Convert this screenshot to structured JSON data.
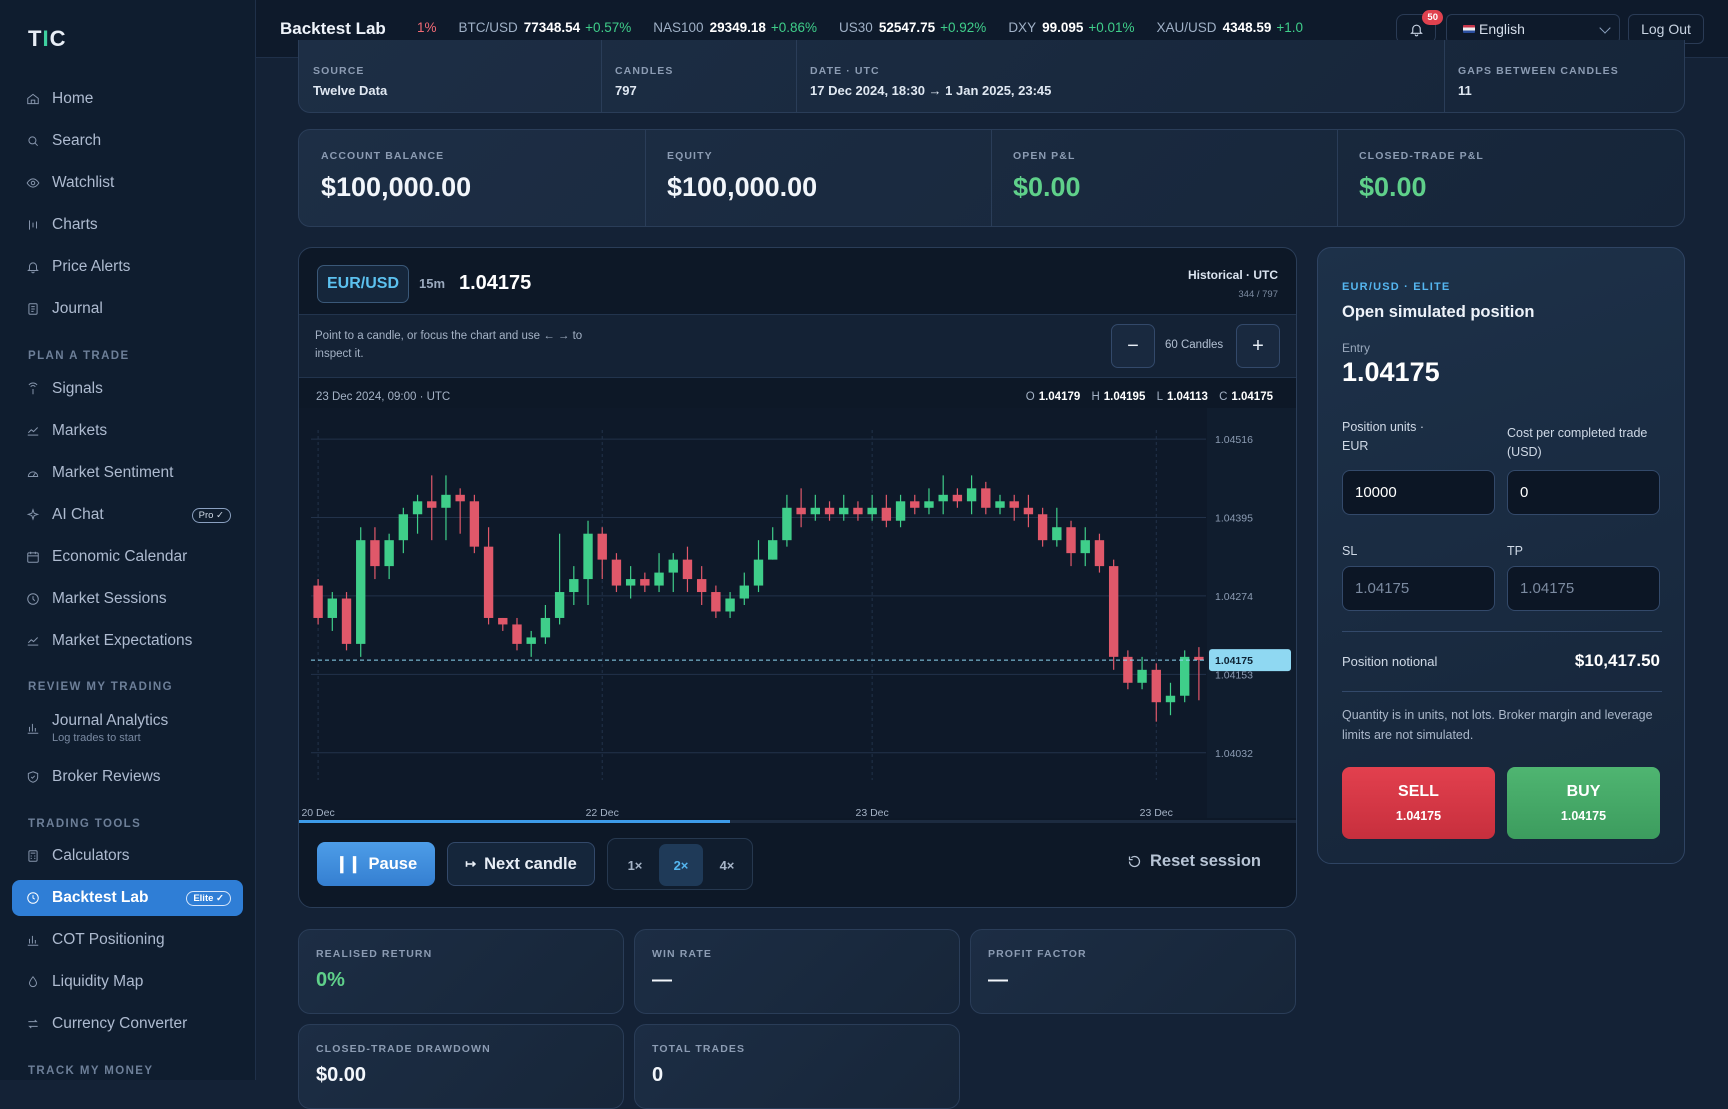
{
  "sidebar": {
    "logo_main": "T",
    "logo_accent": "I",
    "logo_tail": "C",
    "items": [
      {
        "label": "Home",
        "icon": "home-icon"
      },
      {
        "label": "Search",
        "icon": "search-icon"
      },
      {
        "label": "Watchlist",
        "icon": "eye-icon"
      },
      {
        "label": "Charts",
        "icon": "chart-icon"
      },
      {
        "label": "Price Alerts",
        "icon": "bell-icon"
      },
      {
        "label": "Journal",
        "icon": "journal-icon"
      }
    ],
    "section_plan": "PLAN A TRADE",
    "plan_items": [
      {
        "label": "Signals",
        "icon": "signal-icon"
      },
      {
        "label": "Markets",
        "icon": "trend-icon"
      },
      {
        "label": "Market Sentiment",
        "icon": "gauge-icon"
      },
      {
        "label": "AI Chat",
        "icon": "sparkle-icon",
        "badge": "Pro ✓"
      },
      {
        "label": "Economic Calendar",
        "icon": "calendar-icon"
      },
      {
        "label": "Market Sessions",
        "icon": "clock-icon"
      },
      {
        "label": "Market Expectations",
        "icon": "trend-icon"
      }
    ],
    "section_review": "REVIEW MY TRADING",
    "review_items": [
      {
        "label": "Journal Analytics",
        "sub": "Log trades to start",
        "icon": "bar-chart-icon"
      },
      {
        "label": "Broker Reviews",
        "icon": "shield-icon"
      }
    ],
    "section_tools": "TRADING TOOLS",
    "tool_items": [
      {
        "label": "Calculators",
        "icon": "calculator-icon"
      },
      {
        "label": "Backtest Lab",
        "icon": "history-icon",
        "badge": "Elite ✓",
        "active": true
      },
      {
        "label": "COT Positioning",
        "icon": "bar-chart-icon"
      },
      {
        "label": "Liquidity Map",
        "icon": "drop-icon"
      },
      {
        "label": "Currency Converter",
        "icon": "swap-icon"
      }
    ],
    "section_money": "TRACK MY MONEY"
  },
  "topbar": {
    "title": "Backtest Lab",
    "ticker": [
      {
        "sym": "",
        "px": "",
        "ch": "1%",
        "down": true
      },
      {
        "sym": "BTC/USD",
        "px": "77348.54",
        "ch": "+0.57%"
      },
      {
        "sym": "NAS100",
        "px": "29349.18",
        "ch": "+0.86%"
      },
      {
        "sym": "US30",
        "px": "52547.75",
        "ch": "+0.92%"
      },
      {
        "sym": "DXY",
        "px": "99.095",
        "ch": "+0.01%"
      },
      {
        "sym": "XAU/USD",
        "px": "4348.59",
        "ch": "+1.0"
      }
    ],
    "notifications": "50",
    "language": "English",
    "logout": "Log Out"
  },
  "info": [
    {
      "label": "SOURCE",
      "value": "Twelve Data"
    },
    {
      "label": "CANDLES",
      "value": "797"
    },
    {
      "label": "DATE · UTC",
      "value": "17 Dec 2024, 18:30 → 1 Jan 2025, 23:45"
    },
    {
      "label": "GAPS BETWEEN CANDLES",
      "value": "11"
    }
  ],
  "stats": [
    {
      "label": "ACCOUNT BALANCE",
      "value": "$100,000.00"
    },
    {
      "label": "EQUITY",
      "value": "$100,000.00"
    },
    {
      "label": "OPEN P&L",
      "value": "$0.00"
    },
    {
      "label": "CLOSED-TRADE P&L",
      "value": "$0.00"
    }
  ],
  "chart_panel": {
    "pair": "EUR/USD",
    "timeframe": "15m",
    "price": "1.04175",
    "mode": "Historical · UTC",
    "position": "344 / 797",
    "hint": "Point to a candle, or focus the chart and use ← → to inspect it.",
    "zoom_out": "−",
    "zoom_in": "+",
    "zoom_label": "60 Candles",
    "candle_date": "23 Dec 2024, 09:00 · UTC",
    "o_label": "O",
    "o": "1.04179",
    "h_label": "H",
    "h": "1.04195",
    "l_label": "L",
    "l": "1.04113",
    "c_label": "C",
    "c": "1.04175",
    "progress": 0.432,
    "pause": "Pause",
    "next": "Next candle",
    "speeds": [
      "1×",
      "2×",
      "4×"
    ],
    "active_speed": 1,
    "reset": "Reset session"
  },
  "chart_data": {
    "type": "candlestick",
    "ylim": [
      1.0399,
      1.0453
    ],
    "y_ticks": [
      "1.04516",
      "1.04395",
      "1.04274",
      "1.04153",
      "1.04032"
    ],
    "y_tick_values": [
      1.04516,
      1.04395,
      1.04274,
      1.04153,
      1.04032
    ],
    "x_ticks": [
      "20 Dec",
      "22 Dec",
      "23 Dec",
      "23 Dec"
    ],
    "x_tick_index": [
      0,
      20,
      39,
      59
    ],
    "current_price_label": "1.04175",
    "current_price": 1.04175,
    "candles": [
      [
        1.0429,
        1.0424,
        1.043,
        1.0423
      ],
      [
        1.0424,
        1.0427,
        1.0428,
        1.0422
      ],
      [
        1.0427,
        1.042,
        1.0428,
        1.0419
      ],
      [
        1.042,
        1.0436,
        1.0438,
        1.0418
      ],
      [
        1.0436,
        1.0432,
        1.0438,
        1.043
      ],
      [
        1.0432,
        1.0436,
        1.0437,
        1.043
      ],
      [
        1.0436,
        1.044,
        1.0441,
        1.0434
      ],
      [
        1.044,
        1.0442,
        1.0443,
        1.0437
      ],
      [
        1.0442,
        1.0441,
        1.0446,
        1.0436
      ],
      [
        1.0441,
        1.0443,
        1.0446,
        1.0436
      ],
      [
        1.0443,
        1.0442,
        1.0444,
        1.0437
      ],
      [
        1.0442,
        1.0435,
        1.0443,
        1.0434
      ],
      [
        1.0435,
        1.0424,
        1.0438,
        1.0423
      ],
      [
        1.0424,
        1.0423,
        1.0424,
        1.0422
      ],
      [
        1.0423,
        1.042,
        1.0424,
        1.0419
      ],
      [
        1.042,
        1.0421,
        1.0422,
        1.0418
      ],
      [
        1.0421,
        1.0424,
        1.0426,
        1.042
      ],
      [
        1.0424,
        1.0428,
        1.0437,
        1.0423
      ],
      [
        1.0428,
        1.043,
        1.0432,
        1.0426
      ],
      [
        1.043,
        1.0437,
        1.0439,
        1.0426
      ],
      [
        1.0437,
        1.0433,
        1.0438,
        1.043
      ],
      [
        1.0433,
        1.0429,
        1.0434,
        1.0428
      ],
      [
        1.0429,
        1.043,
        1.0432,
        1.0427
      ],
      [
        1.043,
        1.0429,
        1.0431,
        1.0428
      ],
      [
        1.0429,
        1.0431,
        1.0434,
        1.0428
      ],
      [
        1.0431,
        1.0433,
        1.0434,
        1.0428
      ],
      [
        1.0433,
        1.043,
        1.0435,
        1.0428
      ],
      [
        1.043,
        1.0428,
        1.0432,
        1.0426
      ],
      [
        1.0428,
        1.0425,
        1.0429,
        1.0424
      ],
      [
        1.0425,
        1.0427,
        1.0428,
        1.0424
      ],
      [
        1.0427,
        1.0429,
        1.0431,
        1.0426
      ],
      [
        1.0429,
        1.0433,
        1.0436,
        1.0428
      ],
      [
        1.0433,
        1.0436,
        1.0438,
        1.0433
      ],
      [
        1.0436,
        1.0441,
        1.0443,
        1.0435
      ],
      [
        1.0441,
        1.044,
        1.0444,
        1.0438
      ],
      [
        1.044,
        1.0441,
        1.0443,
        1.0439
      ],
      [
        1.0441,
        1.044,
        1.0442,
        1.0439
      ],
      [
        1.044,
        1.0441,
        1.0443,
        1.0439
      ],
      [
        1.0441,
        1.044,
        1.0442,
        1.0439
      ],
      [
        1.044,
        1.0441,
        1.0443,
        1.0439
      ],
      [
        1.0441,
        1.0439,
        1.0443,
        1.0438
      ],
      [
        1.0439,
        1.0442,
        1.0443,
        1.0438
      ],
      [
        1.0442,
        1.0441,
        1.0443,
        1.044
      ],
      [
        1.0441,
        1.0442,
        1.0444,
        1.044
      ],
      [
        1.0442,
        1.0443,
        1.0446,
        1.044
      ],
      [
        1.0443,
        1.0442,
        1.0444,
        1.0441
      ],
      [
        1.0442,
        1.0444,
        1.0446,
        1.044
      ],
      [
        1.0444,
        1.0441,
        1.0445,
        1.044
      ],
      [
        1.0441,
        1.0442,
        1.0443,
        1.044
      ],
      [
        1.0442,
        1.0441,
        1.0443,
        1.0439
      ],
      [
        1.0441,
        1.044,
        1.0443,
        1.0438
      ],
      [
        1.044,
        1.0436,
        1.0441,
        1.0435
      ],
      [
        1.0436,
        1.0438,
        1.0441,
        1.0435
      ],
      [
        1.0438,
        1.0434,
        1.0439,
        1.0432
      ],
      [
        1.0434,
        1.0436,
        1.0438,
        1.0432
      ],
      [
        1.0436,
        1.0432,
        1.0437,
        1.0431
      ],
      [
        1.0432,
        1.0418,
        1.0433,
        1.0416
      ],
      [
        1.0418,
        1.0414,
        1.0419,
        1.0413
      ],
      [
        1.0414,
        1.0416,
        1.0418,
        1.0413
      ],
      [
        1.0416,
        1.0411,
        1.0417,
        1.0408
      ],
      [
        1.0411,
        1.0412,
        1.0414,
        1.0409
      ],
      [
        1.0412,
        1.0418,
        1.0419,
        1.0411
      ],
      [
        1.0418,
        1.04175,
        1.04195,
        1.04113
      ]
    ]
  },
  "trade": {
    "tag": "EUR/USD · ELITE",
    "title": "Open simulated position",
    "entry_label": "Entry",
    "entry": "1.04175",
    "units_label": "Position units ·",
    "units_ccy": "EUR",
    "units_value": "10000",
    "cost_label": "Cost per completed trade",
    "cost_ccy": "(USD)",
    "cost_value": "0",
    "sl_label": "SL",
    "tp_label": "TP",
    "sl_ph": "1.04175",
    "tp_ph": "1.04175",
    "notional_label": "Position notional",
    "notional": "$10,417.50",
    "note": "Quantity is in units, not lots. Broker margin and leverage limits are not simulated.",
    "sell": "SELL",
    "buy": "BUY",
    "sell_px": "1.04175",
    "buy_px": "1.04175"
  },
  "metrics": [
    {
      "label": "REALISED RETURN",
      "value": "0%",
      "green": true
    },
    {
      "label": "WIN RATE",
      "value": "—"
    },
    {
      "label": "PROFIT FACTOR",
      "value": "—"
    },
    {
      "label": "CLOSED-TRADE DRAWDOWN",
      "value": "$0.00"
    },
    {
      "label": "TOTAL TRADES",
      "value": "0"
    }
  ],
  "colors": {
    "up": "#3fce8a",
    "down": "#e0586a",
    "accent": "#3d9be9",
    "price_tag": "#8fd8f2"
  }
}
